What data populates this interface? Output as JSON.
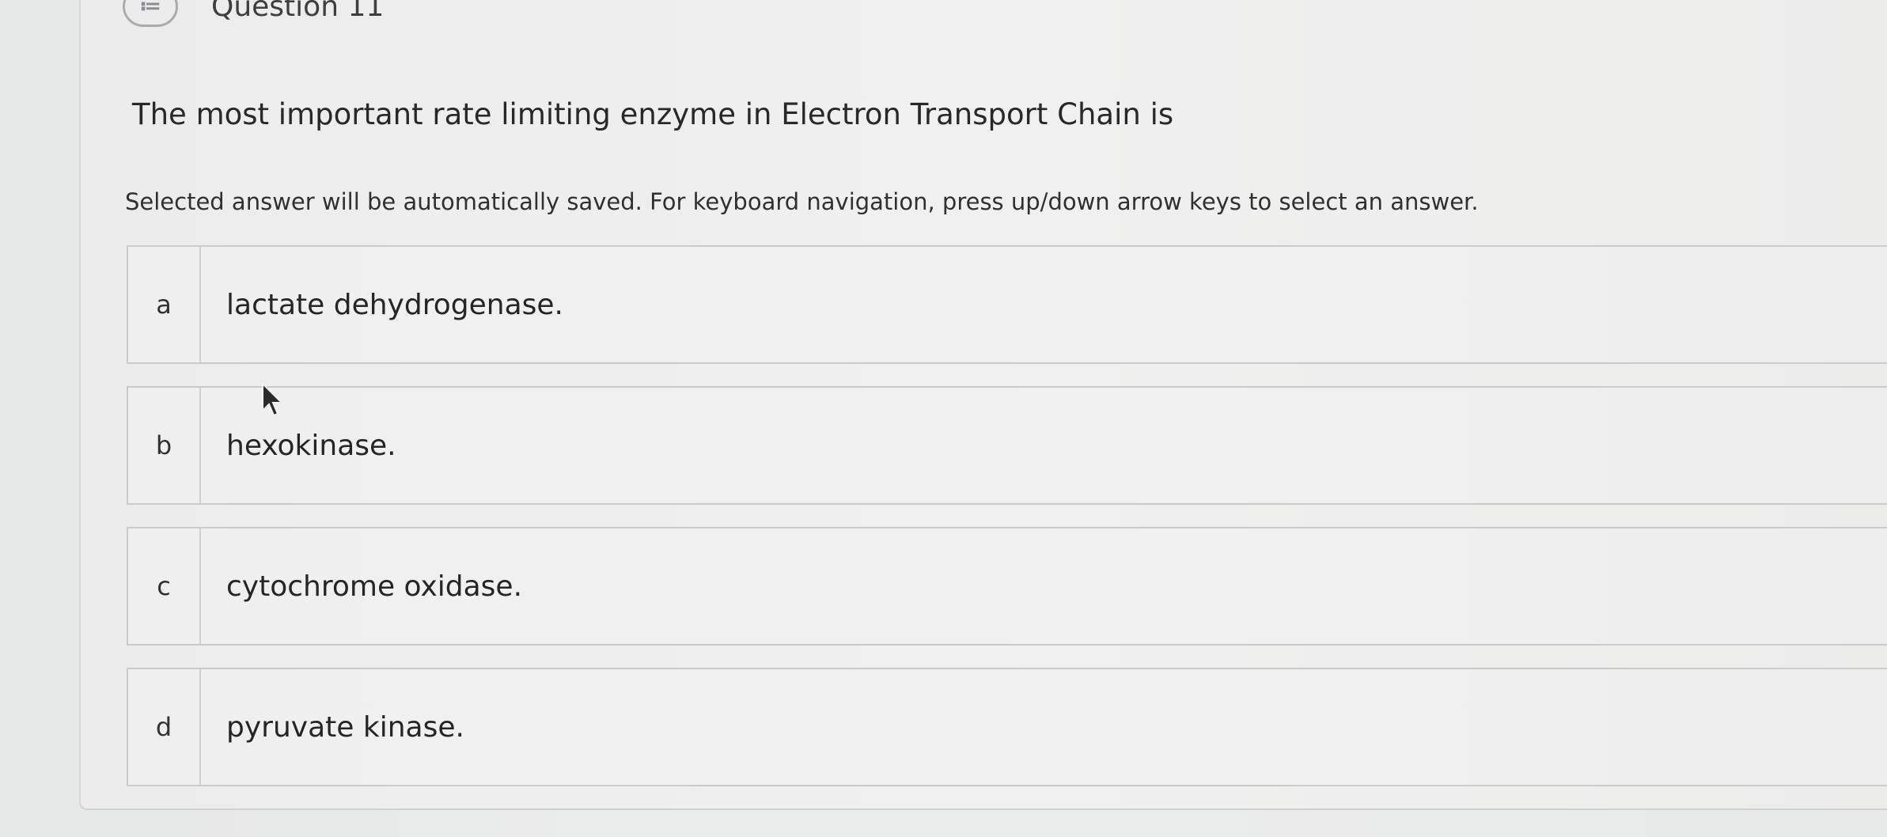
{
  "header": {
    "icon": "list-chat-icon",
    "icon_glyph": "≔",
    "title": "Question 11"
  },
  "question": {
    "prompt": "The most important rate limiting enzyme in Electron Transport Chain is",
    "instructions": "Selected answer will be automatically saved. For keyboard navigation, press up/down arrow keys to select an answer."
  },
  "options": [
    {
      "letter": "a",
      "text": "lactate dehydrogenase."
    },
    {
      "letter": "b",
      "text": "hexokinase."
    },
    {
      "letter": "c",
      "text": "cytochrome oxidase."
    },
    {
      "letter": "d",
      "text": "pyruvate kinase."
    }
  ],
  "colors": {
    "background": "#e9eaea",
    "card": "#efefef",
    "border": "#c9cacb",
    "text": "#26282a"
  }
}
